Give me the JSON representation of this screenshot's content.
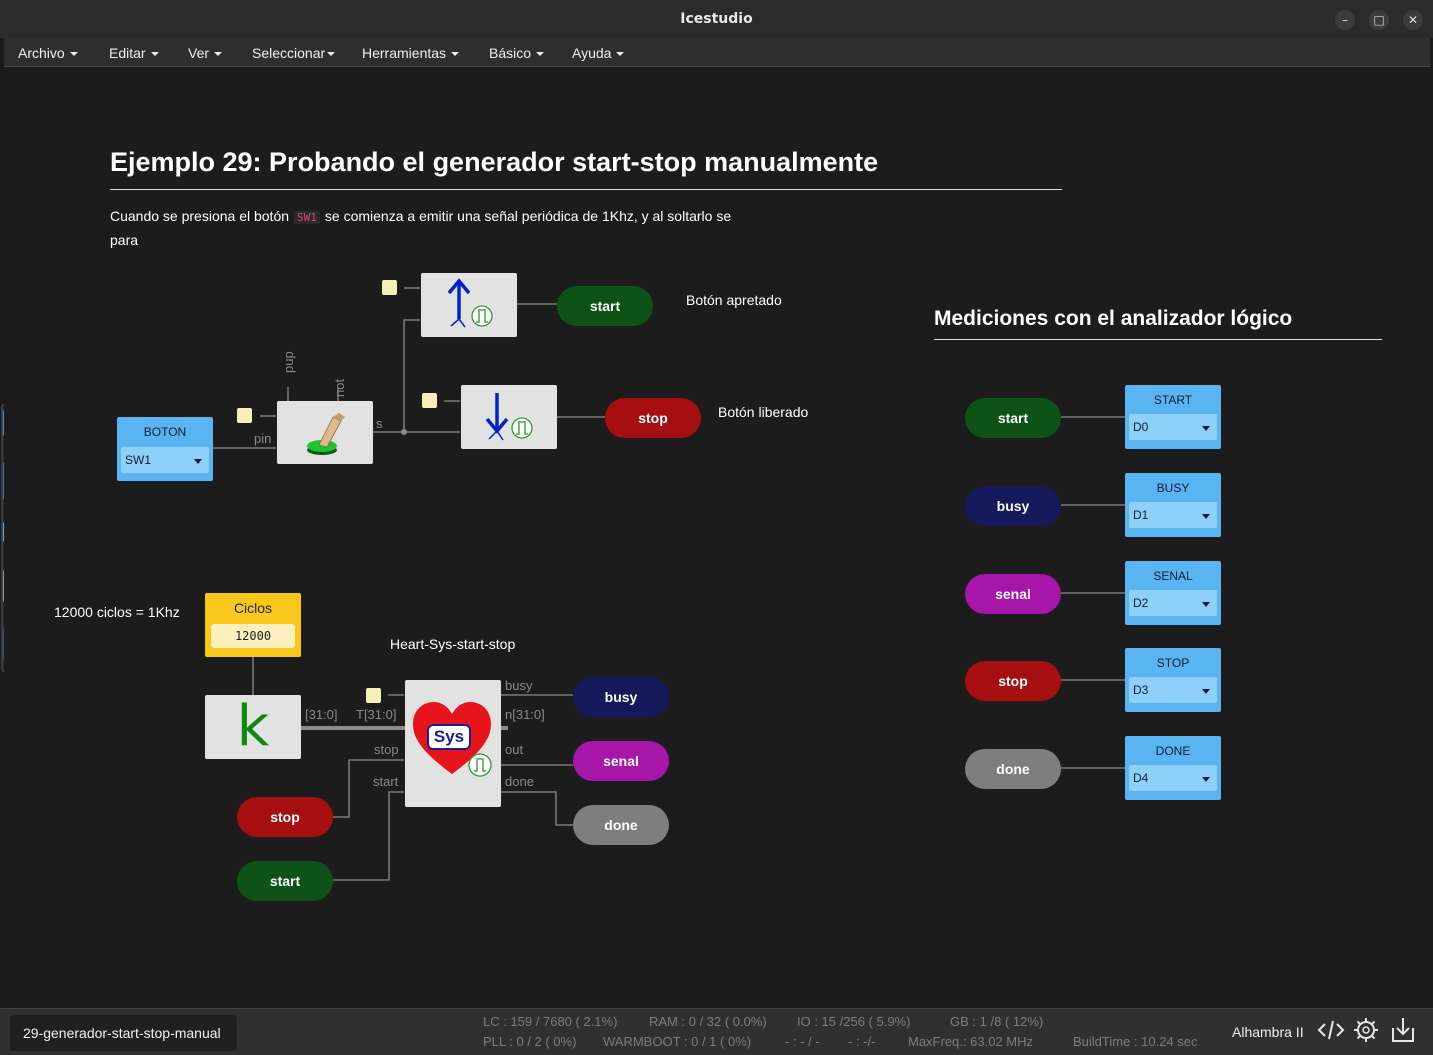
{
  "window": {
    "title": "Icestudio",
    "controls": [
      "–",
      "□",
      "✕"
    ]
  },
  "menu": [
    {
      "label": "Archivo"
    },
    {
      "label": "Editar"
    },
    {
      "label": "Ver"
    },
    {
      "label": "Seleccionar"
    },
    {
      "label": "Herramientas"
    },
    {
      "label": "Básico"
    },
    {
      "label": "Ayuda"
    }
  ],
  "doc": {
    "title": "Ejemplo 29: Probando el generador start-stop manualmente",
    "para_before": "Cuando se presiona el botón",
    "para_code": "SW1",
    "para_after": "se comienza a emitir una señal periódica de 1Khz, y al soltarlo se para",
    "section2": "Mediciones con el analizador lógico",
    "note_pressed": "Botón apretado",
    "note_released": "Botón liberado",
    "note_cycles": "12000 ciclos = 1Khz",
    "note_heart": "Heart-Sys-start-stop"
  },
  "blocks": {
    "boton": {
      "title": "BOTON",
      "value": "SW1"
    },
    "button_pins": {
      "pup": "pup",
      "not": "not",
      "pin": "pin",
      "s": "s"
    },
    "ciclos": {
      "title": "Ciclos",
      "value": "12000"
    },
    "k_label": "k",
    "k_bus": "[31:0]",
    "sys_label": "Sys",
    "heart_pins": {
      "T": "T[31:0]",
      "stop": "stop",
      "start": "start",
      "busy": "busy",
      "n": "n[31:0]",
      "out": "out",
      "done": "done"
    }
  },
  "labels_left": {
    "start_top": "start",
    "stop_top": "stop",
    "busy": "busy",
    "senal": "senal",
    "done": "done",
    "stop_in": "stop",
    "start_in": "start"
  },
  "analyzer": [
    {
      "label": "start",
      "title": "START",
      "channel": "D0"
    },
    {
      "label": "busy",
      "title": "BUSY",
      "channel": "D1"
    },
    {
      "label": "senal",
      "title": "SENAL",
      "channel": "D2"
    },
    {
      "label": "stop",
      "title": "STOP",
      "channel": "D3"
    },
    {
      "label": "done",
      "title": "DONE",
      "channel": "D4"
    }
  ],
  "colors": {
    "green": "#0e5218",
    "red": "#a50f0f",
    "navy": "#15185b",
    "magenta": "#a616a9",
    "gray": "#7e7e7e",
    "blue": "#5ab4f2",
    "yellow": "#f9c81a"
  },
  "status": {
    "file": "29-generador-start-stop-manual",
    "lc": "LC : 159 / 7680 ( 2.1%)",
    "ram": "RAM : 0 / 32 ( 0.0%)",
    "io": "IO :  15 /256  ( 5.9%)",
    "gb": "GB :  1 /8  ( 12%)",
    "pll": "PLL : 0 / 2 ( 0%)",
    "warmboot": "WARMBOOT : 0 / 1 ( 0%)",
    "dash1": "- : - / -",
    "dash2": "- :  -/-",
    "maxfreq": "MaxFreq.:  63.02 MHz",
    "buildtime": "BuildTime :  10.24 sec",
    "board": "Alhambra II",
    "icons": [
      "code-icon",
      "gear-icon",
      "download-icon"
    ]
  }
}
